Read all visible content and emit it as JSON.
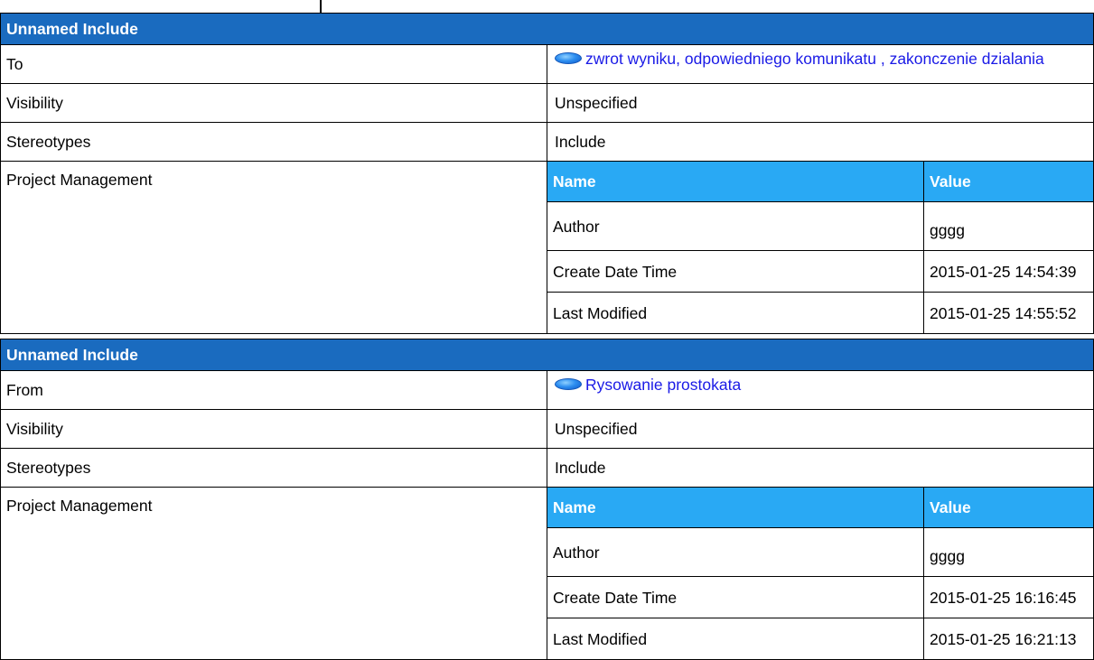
{
  "includes": [
    {
      "title": "Unnamed Include",
      "target_label": "To",
      "target_link": "zwrot wyniku, odpowiedniego komunikatu , zakonczenie dzialania",
      "target_icon": "use-case-ellipse-icon",
      "visibility_label": "Visibility",
      "visibility_value": "Unspecified",
      "stereotypes_label": "Stereotypes",
      "stereotypes_value": "Include",
      "pm_label": "Project Management",
      "tags_header": {
        "name": "Name",
        "value": "Value"
      },
      "tags": [
        {
          "name": "Author",
          "value": "gggg"
        },
        {
          "name": "Create Date Time",
          "value": "2015-01-25 14:54:39"
        },
        {
          "name": "Last Modified",
          "value": "2015-01-25 14:55:52"
        }
      ]
    },
    {
      "title": "Unnamed Include",
      "target_label": "From",
      "target_link": "Rysowanie prostokata",
      "target_icon": "use-case-ellipse-icon",
      "visibility_label": "Visibility",
      "visibility_value": "Unspecified",
      "stereotypes_label": "Stereotypes",
      "stereotypes_value": "Include",
      "pm_label": "Project Management",
      "tags_header": {
        "name": "Name",
        "value": "Value"
      },
      "tags": [
        {
          "name": "Author",
          "value": "gggg"
        },
        {
          "name": "Create Date Time",
          "value": "2015-01-25 16:16:45"
        },
        {
          "name": "Last Modified",
          "value": "2015-01-25 16:21:13"
        }
      ]
    }
  ],
  "colors": {
    "section_header_bg": "#1a6bbf",
    "tags_header_bg": "#29a9f4",
    "link": "#1a1ae6"
  }
}
